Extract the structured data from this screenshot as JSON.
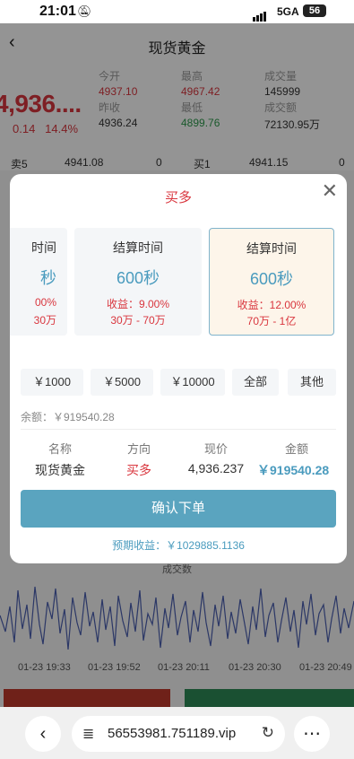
{
  "status_bar": {
    "time": "21:01",
    "network": "5GA",
    "battery": "56"
  },
  "nav": {
    "title": "现货黄金"
  },
  "quote": {
    "price": "4,936....",
    "change": "0.14",
    "change_pct": "14.4%",
    "open_label": "今开",
    "open_value": "4937.10",
    "high_label": "最高",
    "high_value": "4967.42",
    "volume_label": "成交量",
    "volume_value": "145999",
    "prev_close_label": "昨收",
    "prev_close_value": "4936.24",
    "low_label": "最低",
    "low_value": "4899.76",
    "turnover_label": "成交额",
    "turnover_value": "72130.95万"
  },
  "depth": {
    "sell_label": "卖5",
    "sell_price": "4941.08",
    "sell_qty": "0",
    "buy_label": "买1",
    "buy_price": "4941.15",
    "buy_qty": "0"
  },
  "chart": {
    "label": "成交数",
    "times": [
      "01-23 19:33",
      "01-23 19:52",
      "01-23 20:11",
      "01-23 20:30",
      "01-23 20:49"
    ]
  },
  "modal": {
    "title": "买多",
    "cards": [
      {
        "title": "时间",
        "seconds": "秒",
        "yield": "00%",
        "range": "30万"
      },
      {
        "title": "结算时间",
        "seconds": "600秒",
        "yield": "收益：9.00%",
        "range": "30万 - 70万"
      },
      {
        "title": "结算时间",
        "seconds": "600秒",
        "yield": "收益：12.00%",
        "range": "70万 - 1亿"
      }
    ],
    "amount_buttons": [
      "￥1000",
      "￥5000",
      "￥10000",
      "全部",
      "其他"
    ],
    "balance": "余额：￥919540.28",
    "columns": [
      "名称",
      "方向",
      "现价",
      "金额"
    ],
    "row": {
      "name": "现货黄金",
      "direction": "买多",
      "price": "4,936.237",
      "amount": "￥919540.28"
    },
    "confirm": "确认下单",
    "expected": "预期收益：￥1029885.1136"
  },
  "browser": {
    "url": "56553981.751189.vip"
  },
  "colors": {
    "accent_blue": "#5aa4bf",
    "red": "#d9363e",
    "green": "#2e9a4d"
  }
}
